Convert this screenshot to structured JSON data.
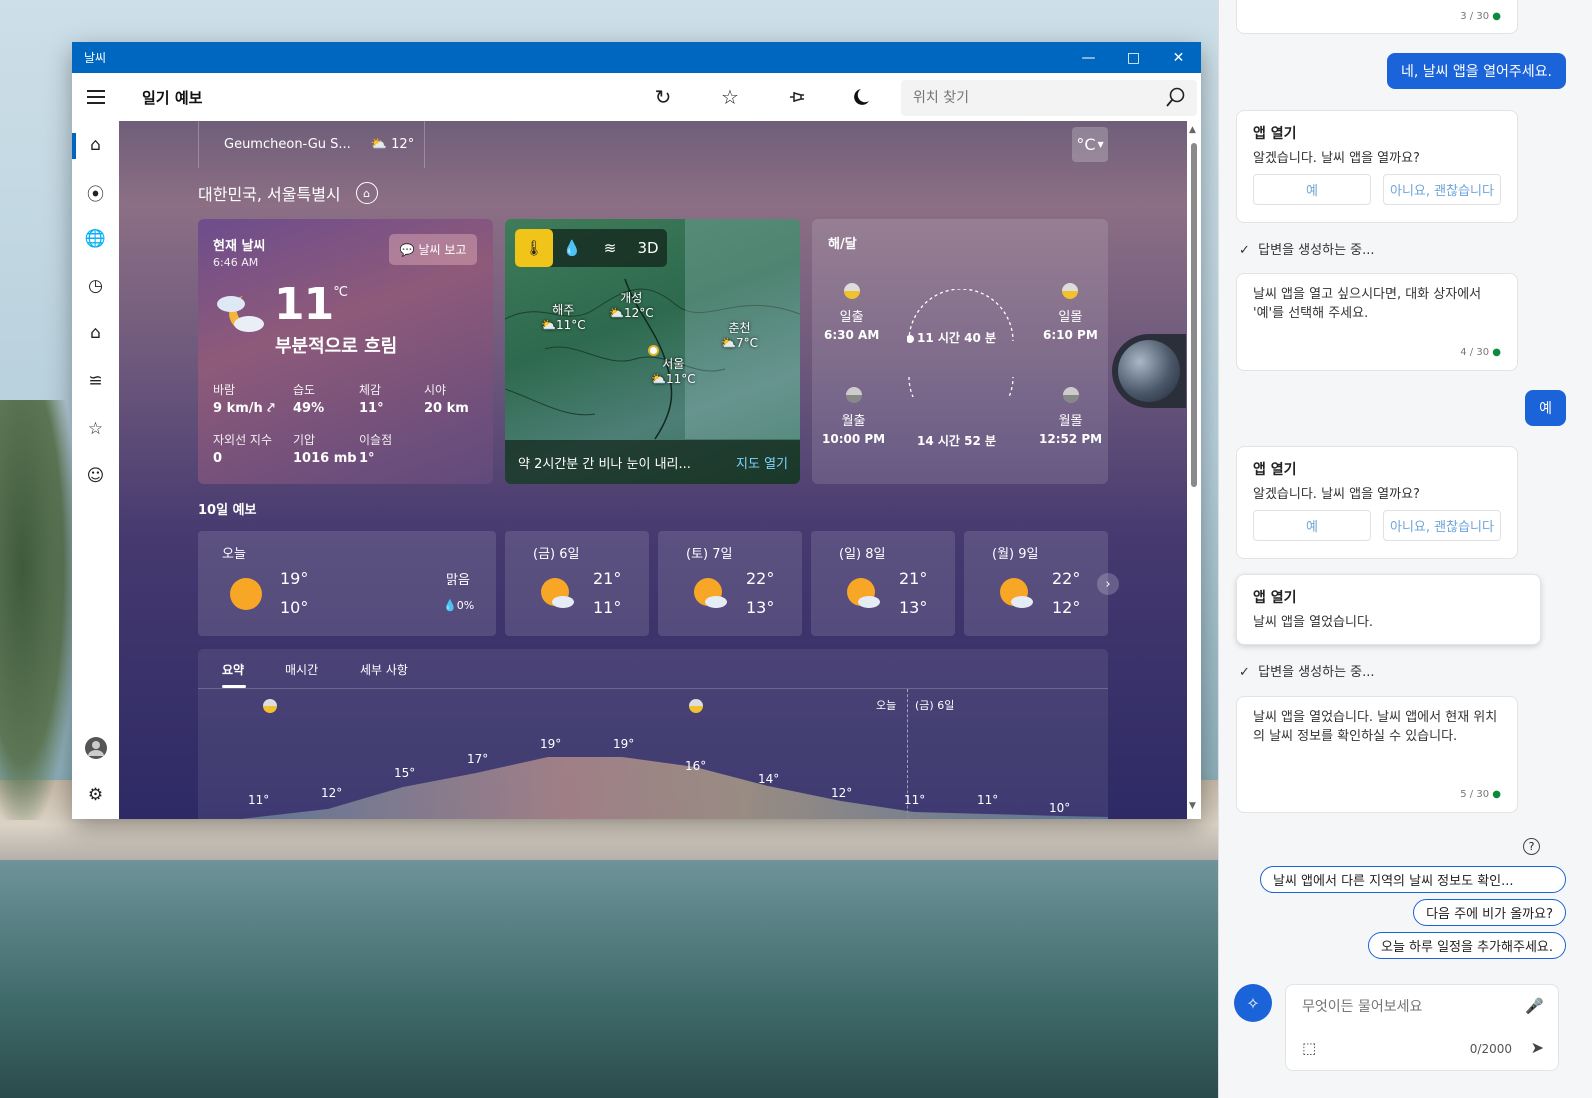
{
  "window": {
    "title": "날씨"
  },
  "toolbar": {
    "app_title": "일기 예보",
    "search_placeholder": "위치 찾기"
  },
  "location_bar": {
    "name": "Geumcheon-Gu S...",
    "temp": "12°",
    "unit": "°C"
  },
  "location_title": "대한민국, 서울특별시",
  "current": {
    "heading": "현재 날씨",
    "time": "6:46 AM",
    "report_label": "날씨 보고",
    "temp": "11",
    "unit": "°C",
    "condition": "부분적으로 흐림",
    "stats": [
      {
        "label": "바람",
        "value": "9 km/h"
      },
      {
        "label": "습도",
        "value": "49%"
      },
      {
        "label": "체감",
        "value": "11°"
      },
      {
        "label": "시야",
        "value": "20 km"
      },
      {
        "label": "자외선 지수",
        "value": "0"
      },
      {
        "label": "기압",
        "value": "1016 mb"
      },
      {
        "label": "이슬점",
        "value": "1°"
      }
    ]
  },
  "map": {
    "tools": [
      "thermometer-icon",
      "droplet-icon",
      "wind-icon",
      "3D"
    ],
    "tool_3d": "3D",
    "cities": [
      {
        "name": "해주",
        "temp": "11°C"
      },
      {
        "name": "개성",
        "temp": "12°C"
      },
      {
        "name": "춘천",
        "temp": "7°C"
      },
      {
        "name": "서울",
        "temp": "11°C"
      }
    ],
    "alert": "약 2시간분 간 비나 눈이 내리...",
    "open_map": "지도 열기"
  },
  "sunmoon": {
    "heading": "해/달",
    "sunrise_label": "일출",
    "sunrise": "6:30 AM",
    "sunset_label": "일몰",
    "sunset": "6:10 PM",
    "day_length": "11 시간 40 분",
    "moonrise_label": "월출",
    "moonrise": "10:00 PM",
    "moonset_label": "월몰",
    "moonset": "12:52 PM",
    "moon_length": "14 시간 52 분"
  },
  "forecast": {
    "heading": "10일 예보",
    "today": {
      "label": "오늘",
      "hi": "19°",
      "lo": "10°",
      "cond": "맑음",
      "precip": "0%"
    },
    "days": [
      {
        "label": "(금) 6일",
        "hi": "21°",
        "lo": "11°"
      },
      {
        "label": "(토) 7일",
        "hi": "22°",
        "lo": "13°"
      },
      {
        "label": "(일) 8일",
        "hi": "21°",
        "lo": "13°"
      },
      {
        "label": "(월) 9일",
        "hi": "22°",
        "lo": "12°"
      }
    ]
  },
  "detail": {
    "tabs": [
      "요약",
      "매시간",
      "세부 사항"
    ],
    "today_marker": "오늘",
    "next_marker": "(금) 6일",
    "hourly_temps": [
      "11°",
      "12°",
      "15°",
      "17°",
      "19°",
      "19°",
      "16°",
      "14°",
      "12°",
      "11°",
      "11°",
      "10°"
    ]
  },
  "copilot": {
    "top_counter": "3 / 30",
    "user_msg_1": "네, 날씨 앱을 열어주세요.",
    "card1": {
      "title": "앱 열기",
      "text": "알겠습니다. 날씨 앱을 열까요?",
      "yes": "예",
      "no": "아니요, 괜찮습니다"
    },
    "generating": "답변을 생성하는 중...",
    "reply1": "날씨 앱을 열고 싶으시다면, 대화 상자에서 '예'를 선택해 주세요.",
    "reply1_counter": "4 / 30",
    "user_msg_2": "예",
    "card2": {
      "title": "앱 열기",
      "text": "알겠습니다. 날씨 앱을 열까요?",
      "yes": "예",
      "no": "아니요, 괜찮습니다"
    },
    "card3": {
      "title": "앱 열기",
      "text": "날씨 앱을 열었습니다."
    },
    "generating2": "답변을 생성하는 중...",
    "reply2": "날씨 앱을 열었습니다. 날씨 앱에서 현재 위치의 날씨 정보를 확인하실 수 있습니다.",
    "reply2_counter": "5 / 30",
    "suggestions": [
      "날씨 앱에서 다른 지역의 날씨 정보도 확인...",
      "다음 주에 비가 올까요?",
      "오늘 하루 일정을 추가해주세요."
    ],
    "input_placeholder": "무엇이든 물어보세요",
    "char_count": "0/2000"
  },
  "colors": {
    "accent": "#0067c0",
    "copilot_accent": "#1b63d8",
    "map_tool_active": "#f0c419"
  }
}
